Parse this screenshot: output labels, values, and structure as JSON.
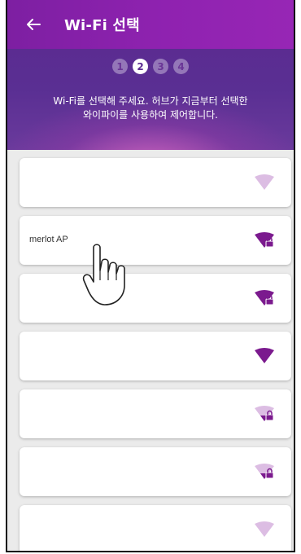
{
  "appbar": {
    "title": "Wi-Fi 선택",
    "back_icon": "arrow-left-icon"
  },
  "header": {
    "steps": [
      "1",
      "2",
      "3",
      "4"
    ],
    "active_step": 2,
    "instruction_line1": "Wi-Fi를 선택해 주세요. 허브가 지금부터 선택한",
    "instruction_line2": "와이파이를 사용하여 제어합니다."
  },
  "networks": [
    {
      "name": "",
      "signal": "weak",
      "locked": false
    },
    {
      "name": "merlot AP",
      "signal": "full",
      "locked": true
    },
    {
      "name": "",
      "signal": "full",
      "locked": true
    },
    {
      "name": "",
      "signal": "full",
      "locked": false
    },
    {
      "name": "",
      "signal": "weak",
      "locked": true
    },
    {
      "name": "",
      "signal": "weak",
      "locked": true
    },
    {
      "name": "",
      "signal": "weak",
      "locked": false
    }
  ],
  "colors": {
    "primary": "#8a20ac",
    "header_bg": "#5b2c91",
    "wifi_strong": "#7b1a8e",
    "wifi_weak": "#d9b7e0",
    "list_bg": "#ebebeb"
  }
}
